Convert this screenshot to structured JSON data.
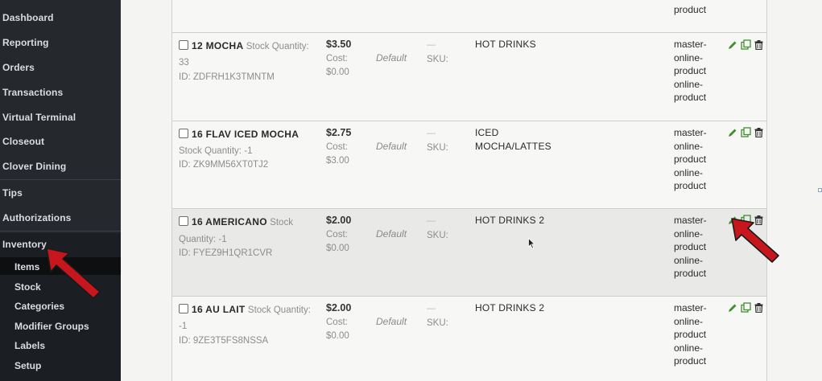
{
  "sidebar": {
    "items": [
      {
        "label": "Dashboard"
      },
      {
        "label": "Reporting"
      },
      {
        "label": "Orders"
      },
      {
        "label": "Transactions"
      },
      {
        "label": "Virtual Terminal"
      },
      {
        "label": "Closeout"
      },
      {
        "label": "Clover Dining"
      },
      {
        "label": "Tips"
      },
      {
        "label": "Authorizations"
      },
      {
        "label": "Inventory"
      }
    ],
    "inventory_sub": [
      {
        "label": "Items"
      },
      {
        "label": "Stock"
      },
      {
        "label": "Categories"
      },
      {
        "label": "Modifier Groups"
      },
      {
        "label": "Labels"
      },
      {
        "label": "Setup"
      }
    ]
  },
  "table": {
    "partial_row_tag": "product",
    "rows": [
      {
        "name": "12 MOCHA",
        "stock_label": "Stock Quantity:",
        "stock_value": "33",
        "id": "ID: ZDFRH1K3TMNTM",
        "price": "$3.50",
        "cost_label": "Cost:",
        "cost_value": "$0.00",
        "pricing": "Default",
        "dash": "—",
        "sku_label": "SKU:",
        "category_line1": "HOT DRINKS",
        "category_line2": "",
        "tags": [
          "master-",
          "online-",
          "product",
          "online-",
          "product"
        ]
      },
      {
        "name": "16 FLAV ICED MOCHA",
        "stock_label": "Stock Quantity:",
        "stock_value": "-1",
        "id": "ID: ZK9MM56XT0TJ2",
        "price": "$2.75",
        "cost_label": "Cost:",
        "cost_value": "$3.00",
        "pricing": "Default",
        "dash": "—",
        "sku_label": "SKU:",
        "category_line1": "ICED",
        "category_line2": "MOCHA/LATTES",
        "tags": [
          "master-",
          "online-",
          "product",
          "online-",
          "product"
        ]
      },
      {
        "name": "16 AMERICANO",
        "stock_label": "Stock",
        "stock_label2": "Quantity:",
        "stock_value": "-1",
        "id": "ID: FYEZ9H1QR1CVR",
        "price": "$2.00",
        "cost_label": "Cost:",
        "cost_value": "$0.00",
        "pricing": "Default",
        "dash": "—",
        "sku_label": "SKU:",
        "category_line1": "HOT DRINKS 2",
        "category_line2": "",
        "tags": [
          "master-",
          "online-",
          "product",
          "online-",
          "product"
        ]
      },
      {
        "name": "16 AU LAIT",
        "stock_label": "Stock Quantity:",
        "stock_value": "-1",
        "id": "ID: 9ZE3T5FS8NSSA",
        "price": "$2.00",
        "cost_label": "Cost:",
        "cost_value": "$0.00",
        "pricing": "Default",
        "dash": "—",
        "sku_label": "SKU:",
        "category_line1": "HOT DRINKS 2",
        "category_line2": "",
        "tags": [
          "master-",
          "online-",
          "product",
          "online-",
          "product"
        ]
      }
    ]
  },
  "colors": {
    "sidebar_bg": "#25292e",
    "edit_icon": "#3f8f2f",
    "copy_icon": "#3f8f2f",
    "arrow_red": "#c8161d"
  }
}
